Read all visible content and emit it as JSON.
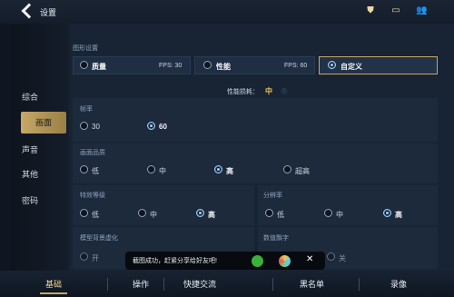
{
  "header": {
    "title": "设置",
    "icons": [
      "back-icon",
      "notification-icon",
      "chat-icon",
      "friends-icon"
    ]
  },
  "sidebar": {
    "items": [
      {
        "label": "综合"
      },
      {
        "label": "画面",
        "active": true
      },
      {
        "label": "声音"
      },
      {
        "label": "其他"
      },
      {
        "label": "密码"
      }
    ]
  },
  "graphics": {
    "section_title": "图形设置",
    "presets": [
      {
        "label": "质量",
        "fps_text": "FPS: 30",
        "selected": false
      },
      {
        "label": "性能",
        "fps_text": "FPS: 60",
        "selected": false
      },
      {
        "label": "自定义",
        "fps_text": "",
        "selected": true
      }
    ],
    "performance_label": "性能损耗：",
    "performance_value": "中",
    "frame_rate": {
      "title": "帧率",
      "options": [
        {
          "label": "30",
          "selected": false
        },
        {
          "label": "60",
          "selected": true
        }
      ]
    },
    "image_quality": {
      "title": "画面品质",
      "options": [
        {
          "label": "低",
          "selected": false
        },
        {
          "label": "中",
          "selected": false
        },
        {
          "label": "高",
          "selected": true
        },
        {
          "label": "超高",
          "selected": false
        }
      ]
    },
    "effects": {
      "title": "特效等级",
      "options": [
        {
          "label": "低",
          "selected": false
        },
        {
          "label": "中",
          "selected": false
        },
        {
          "label": "高",
          "selected": true
        }
      ]
    },
    "resolution": {
      "title": "分辨率",
      "options": [
        {
          "label": "低",
          "selected": false
        },
        {
          "label": "中",
          "selected": false
        },
        {
          "label": "高",
          "selected": true
        }
      ]
    },
    "model_blur": {
      "title": "模型背景虚化",
      "options": [
        {
          "label": "开",
          "selected": false
        }
      ]
    },
    "damage_numbers": {
      "title": "数值飘字",
      "options": [
        {
          "label": "关",
          "selected": false
        }
      ]
    }
  },
  "toast": {
    "text": "截图成功，赶紧分享给好友吧!",
    "close": "✕"
  },
  "bottom_tabs": [
    {
      "label": "基础",
      "active": true
    },
    {
      "label": "操作"
    },
    {
      "label": "快捷交流"
    },
    {
      "label": "黑名单"
    },
    {
      "label": "录像"
    }
  ],
  "colors": {
    "accent": "#c7a866",
    "selected_radio": "#9fd0ff",
    "bg": "#0f1621"
  }
}
